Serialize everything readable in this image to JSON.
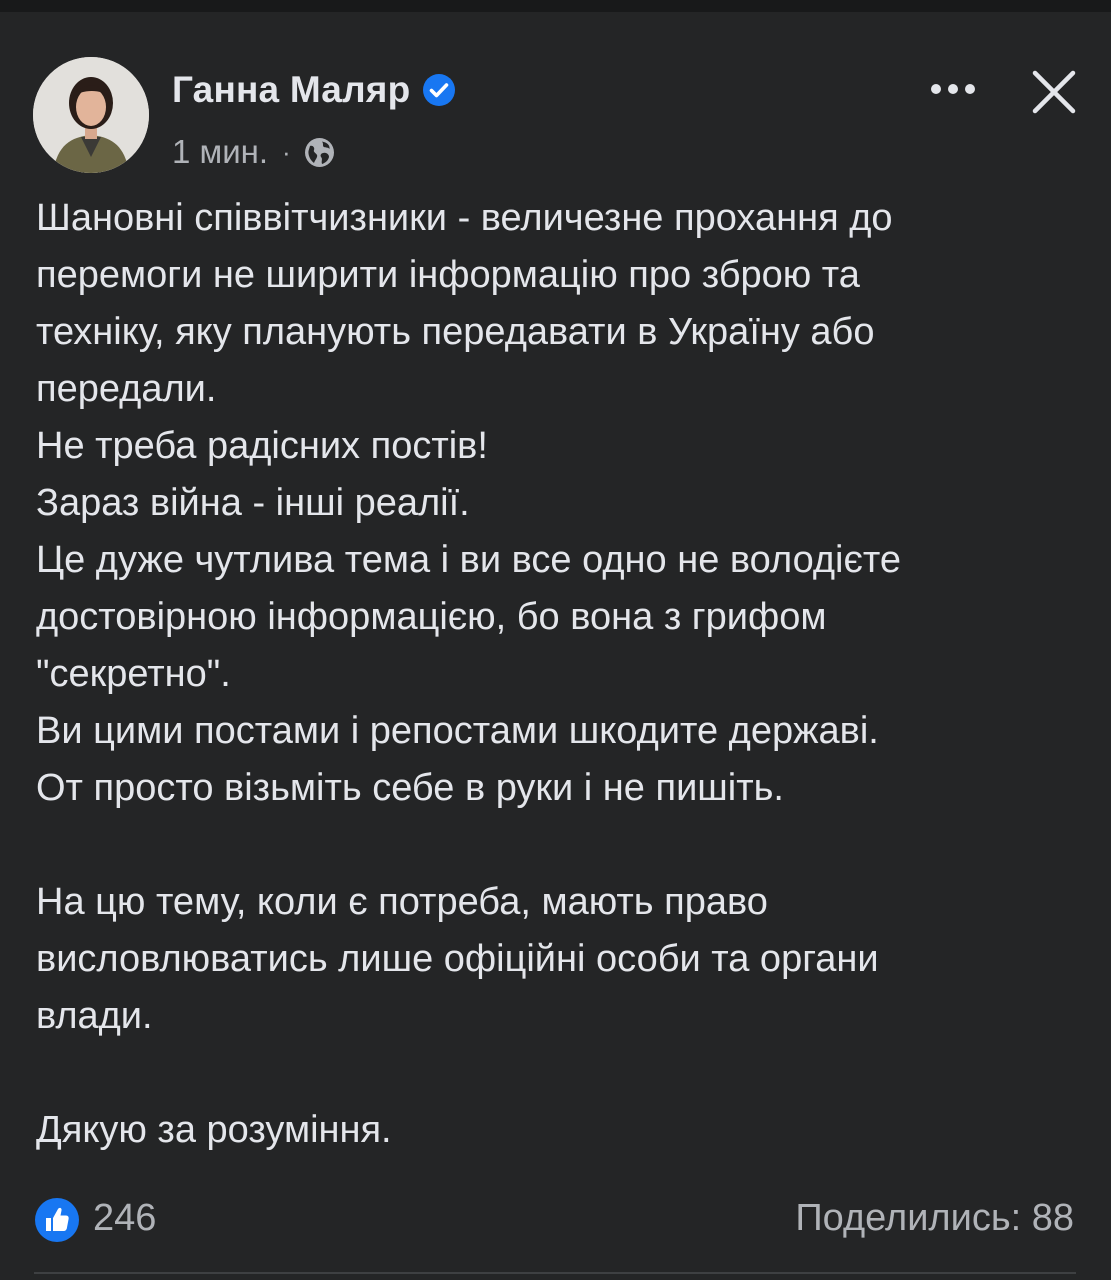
{
  "post": {
    "author": "Ганна Маляр",
    "timestamp": "1 мин.",
    "separator": "·",
    "verified": true,
    "privacy_icon": "globe-icon",
    "lines": [
      "Шановні співвітчизники - величезне прохання  до",
      "перемоги не ширити інформацію про зброю та",
      "техніку, яку планують передавати в Україну або",
      "передали.",
      "Не треба радісних постів!",
      "Зараз війна - інші реалії.",
      "Це дуже чутлива тема і ви все одно не володієте",
      "достовірною інформацією, бо вона з грифом",
      "\"секретно\".",
      "Ви цими постами і репостами шкодите державі.",
      "От просто візьміть себе в руки і не пишіть.",
      "",
      "На цю тему, коли є потреба, мають право",
      "висловлюватись лише офіційні особи та органи",
      "влади.",
      "",
      "Дякую за розуміння."
    ]
  },
  "reactions": {
    "like_count": "246",
    "shares_label": "Поделились: 88"
  },
  "colors": {
    "background": "#242526",
    "text": "#e4e6eb",
    "secondary_text": "#b0b3b8",
    "accent_blue": "#1877f2"
  },
  "icons": {
    "more": "more-options-icon",
    "close": "close-icon",
    "verified": "verified-badge-icon",
    "like": "like-reaction-icon"
  }
}
